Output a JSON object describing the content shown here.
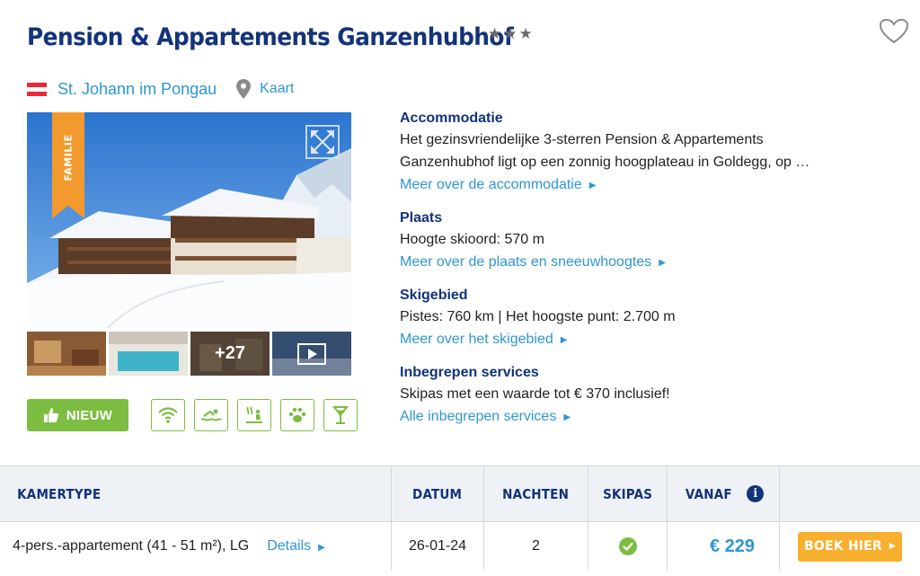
{
  "header": {
    "title": "Pension & Appartements Ganzenhubhof",
    "stars": "★★★",
    "favorite_icon": "heart-icon"
  },
  "location": {
    "place": "St. Johann im Pongau",
    "map_link": "Kaart",
    "flag_colors": [
      "#ed2939",
      "#ffffff",
      "#ed2939"
    ]
  },
  "gallery": {
    "ribbon_label": "FAMILIE",
    "more_photos": "+27"
  },
  "badges": {
    "new_label": "NIEUW",
    "amenities": [
      "wifi-icon",
      "swimming-icon",
      "sauna-icon",
      "pets-icon",
      "bar-icon"
    ]
  },
  "info": {
    "accommodation": {
      "heading": "Accommodatie",
      "text_line1": "Het gezinsvriendelijke 3-sterren Pension & Appartements",
      "text_line2": "Ganzenhubhof ligt op een zonnig hoogplateau in Goldegg, op …",
      "link": "Meer over de accommodatie"
    },
    "place": {
      "heading": "Plaats",
      "text": "Hoogte skioord: 570 m",
      "link": "Meer over de plaats en sneeuwhoogtes"
    },
    "ski_area": {
      "heading": "Skigebied",
      "text": "Pistes: 760 km | Het hoogste punt: 2.700 m",
      "link": "Meer over het skigebied"
    },
    "services": {
      "heading": "Inbegrepen services",
      "text": "Skipas met een waarde tot € 370 inclusief!",
      "link": "Alle inbegrepen services"
    }
  },
  "table": {
    "headers": {
      "room_type": "KAMERTYPE",
      "date": "DATUM",
      "nights": "NACHTEN",
      "skipass": "SKIPAS",
      "from": "VANAF"
    },
    "rows": [
      {
        "room": "4-pers.-appartement (41 - 51 m²), LG",
        "details": "Details",
        "date": "26-01-24",
        "nights": "2",
        "price": "€ 229",
        "book": "BOEK HIER"
      }
    ]
  },
  "colors": {
    "navy": "#13337a",
    "link_blue": "#2e96d4",
    "green": "#7cbd42",
    "orange": "#f6b02e",
    "ribbon": "#f39a2e"
  }
}
